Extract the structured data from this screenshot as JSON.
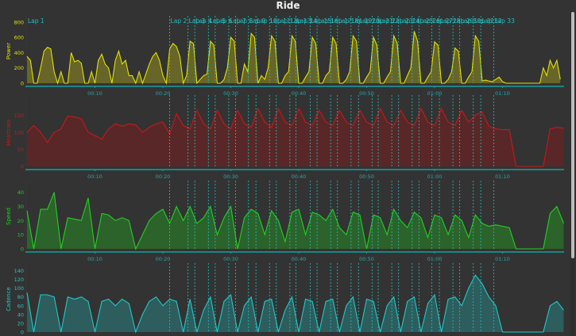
{
  "title": "Ride",
  "colors": {
    "background": "#333333",
    "axis": "#1a9e9e",
    "tick_label": "#2aa6a6",
    "lap_marker": "#1fc0c0"
  },
  "chart_data": {
    "type": "area",
    "x_axis": {
      "unit": "minutes",
      "ticks": [
        10,
        20,
        30,
        40,
        50,
        60,
        70
      ],
      "tick_labels": [
        "00:10",
        "00:20",
        "00:30",
        "00:40",
        "00:50",
        "01:00",
        "01:10"
      ],
      "range": [
        0,
        79
      ]
    },
    "laps": {
      "labels": [
        "Lap 1",
        "Lap 2",
        "Lap 3",
        "Lap 4",
        "Lap 5",
        "Lap 6",
        "Lap 7",
        "Lap 8",
        "Lap 9",
        "Lap 10",
        "Lap 11",
        "Lap 12",
        "Lap 13",
        "Lap 14",
        "Lap 15",
        "Lap 16",
        "Lap 17",
        "Lap 18",
        "Lap 19",
        "Lap 20",
        "Lap 21",
        "Lap 22",
        "Lap 23",
        "Lap 24",
        "Lap 25",
        "Lap 26",
        "Lap 27",
        "Lap 28",
        "Lap 29",
        "Lap 30",
        "Lap 31",
        "Lap 32",
        "Lap 33"
      ],
      "start_min": [
        0,
        21.0,
        23.7,
        24.7,
        26.7,
        27.7,
        29.7,
        30.7,
        32.6,
        33.7,
        35.7,
        36.7,
        38.7,
        39.6,
        41.7,
        42.7,
        44.7,
        45.7,
        47.7,
        48.8,
        50.8,
        51.7,
        53.7,
        54.7,
        56.7,
        57.7,
        59.6,
        60.7,
        62.7,
        63.7,
        65.7,
        66.8,
        68.7
      ]
    },
    "series": [
      {
        "name": "Power",
        "color": "#e2e000",
        "fill": "#6b6828",
        "ylim": [
          0,
          840
        ],
        "yticks": [
          0,
          200,
          400,
          600,
          800
        ],
        "sample_interval_min": 0.5,
        "values": [
          350,
          300,
          0,
          0,
          200,
          420,
          470,
          450,
          150,
          0,
          150,
          0,
          0,
          400,
          280,
          300,
          260,
          0,
          0,
          150,
          0,
          300,
          380,
          250,
          200,
          0,
          300,
          420,
          250,
          300,
          100,
          100,
          0,
          150,
          0,
          120,
          250,
          350,
          400,
          300,
          100,
          0,
          450,
          520,
          480,
          350,
          0,
          100,
          550,
          520,
          0,
          50,
          100,
          120,
          550,
          500,
          0,
          0,
          50,
          200,
          600,
          550,
          0,
          0,
          250,
          150,
          650,
          600,
          0,
          100,
          50,
          200,
          620,
          550,
          0,
          0,
          100,
          150,
          620,
          550,
          0,
          0,
          80,
          150,
          600,
          520,
          0,
          0,
          100,
          150,
          600,
          520,
          0,
          0,
          50,
          150,
          620,
          550,
          0,
          0,
          80,
          150,
          600,
          500,
          0,
          0,
          80,
          150,
          620,
          520,
          0,
          0,
          100,
          200,
          680,
          550,
          0,
          0,
          80,
          150,
          540,
          500,
          0,
          0,
          50,
          150,
          460,
          420,
          0,
          0,
          80,
          150,
          620,
          550,
          30,
          40,
          30,
          20,
          50,
          80,
          20,
          0,
          0,
          0,
          0,
          0,
          0,
          0,
          0,
          0,
          0,
          0,
          200,
          100,
          300,
          200,
          300,
          50
        ]
      },
      {
        "name": "Heartrate",
        "color": "#c41a1a",
        "fill": "#5c2727",
        "ylim": [
          0,
          200
        ],
        "yticks": [
          0,
          50,
          100,
          150
        ],
        "sample_interval_min": 1,
        "values": [
          100,
          120,
          100,
          70,
          100,
          110,
          148,
          145,
          140,
          100,
          90,
          80,
          110,
          125,
          118,
          125,
          122,
          100,
          115,
          125,
          130,
          95,
          155,
          120,
          110,
          165,
          125,
          110,
          165,
          125,
          110,
          165,
          125,
          115,
          170,
          130,
          115,
          170,
          130,
          120,
          170,
          130,
          120,
          165,
          130,
          120,
          165,
          130,
          120,
          165,
          130,
          120,
          170,
          130,
          120,
          165,
          130,
          120,
          170,
          130,
          120,
          170,
          130,
          120,
          165,
          130,
          150,
          160,
          118,
          110,
          108,
          108,
          0,
          0,
          0,
          0,
          0,
          110,
          115,
          112
        ]
      },
      {
        "name": "Speed",
        "color": "#22d022",
        "fill": "#2b662b",
        "ylim": [
          0,
          46
        ],
        "yticks": [
          0,
          10,
          20,
          30,
          40
        ],
        "sample_interval_min": 1,
        "values": [
          27,
          0,
          28,
          28,
          40,
          0,
          22,
          21,
          20,
          36,
          0,
          25,
          24,
          20,
          22,
          20,
          0,
          10,
          20,
          25,
          28,
          18,
          30,
          20,
          30,
          18,
          22,
          30,
          10,
          22,
          30,
          0,
          22,
          28,
          25,
          10,
          27,
          20,
          5,
          26,
          28,
          10,
          26,
          24,
          20,
          28,
          15,
          10,
          26,
          24,
          0,
          24,
          22,
          10,
          28,
          20,
          15,
          26,
          22,
          8,
          24,
          22,
          10,
          24,
          20,
          8,
          24,
          18,
          16,
          17,
          16,
          15,
          0,
          0,
          0,
          0,
          0,
          25,
          30,
          18
        ]
      },
      {
        "name": "Cadence",
        "color": "#22c8c8",
        "fill": "#2d6060",
        "ylim": [
          0,
          150
        ],
        "yticks": [
          0,
          20,
          40,
          60,
          80,
          100,
          120,
          140
        ],
        "sample_interval_min": 1,
        "values": [
          90,
          0,
          85,
          85,
          80,
          0,
          80,
          75,
          80,
          70,
          0,
          70,
          75,
          60,
          75,
          65,
          0,
          40,
          70,
          80,
          60,
          75,
          70,
          0,
          75,
          0,
          50,
          80,
          0,
          70,
          85,
          0,
          60,
          80,
          0,
          70,
          75,
          0,
          50,
          80,
          0,
          75,
          70,
          0,
          70,
          75,
          0,
          60,
          80,
          0,
          75,
          70,
          0,
          60,
          80,
          0,
          70,
          80,
          0,
          65,
          85,
          0,
          75,
          80,
          60,
          100,
          130,
          110,
          80,
          60,
          0,
          0,
          0,
          0,
          0,
          0,
          0,
          60,
          70,
          50
        ]
      }
    ]
  }
}
